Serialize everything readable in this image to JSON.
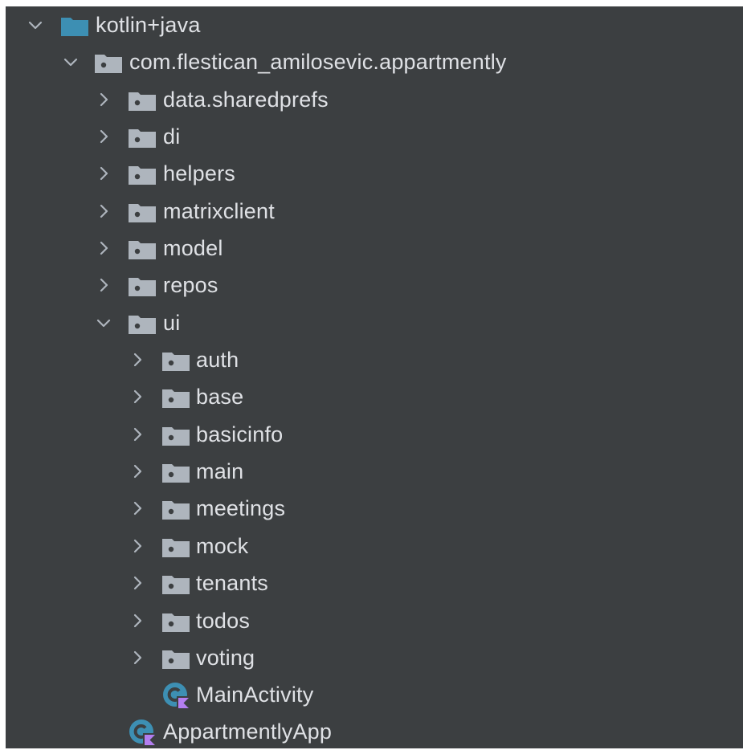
{
  "colors": {
    "background": "#3c3f41",
    "text": "#dfe1e5",
    "source_root_folder": "#3d8fb3",
    "package_folder": "#aeb5bd",
    "chevron": "#aeb5bd",
    "class_icon": "#3d8fb3",
    "kotlin_badge": "#b37ef0"
  },
  "tree": {
    "root": {
      "label": "kotlin+java",
      "expanded": true,
      "icon": "source-root-folder-icon"
    },
    "package": {
      "label": "com.flestican_amilosevic.appartmently",
      "expanded": true,
      "icon": "package-folder-icon"
    },
    "level2": [
      {
        "label": "data.sharedprefs",
        "expanded": false
      },
      {
        "label": "di",
        "expanded": false
      },
      {
        "label": "helpers",
        "expanded": false
      },
      {
        "label": "matrixclient",
        "expanded": false
      },
      {
        "label": "model",
        "expanded": false
      },
      {
        "label": "repos",
        "expanded": false
      },
      {
        "label": "ui",
        "expanded": true
      }
    ],
    "ui_children": [
      {
        "label": "auth",
        "expanded": false
      },
      {
        "label": "base",
        "expanded": false
      },
      {
        "label": "basicinfo",
        "expanded": false
      },
      {
        "label": "main",
        "expanded": false
      },
      {
        "label": "meetings",
        "expanded": false
      },
      {
        "label": "mock",
        "expanded": false
      },
      {
        "label": "tenants",
        "expanded": false
      },
      {
        "label": "todos",
        "expanded": false
      },
      {
        "label": "voting",
        "expanded": false
      }
    ],
    "ui_files": [
      {
        "label": "MainActivity",
        "icon": "kotlin-class-icon"
      }
    ],
    "package_files": [
      {
        "label": "AppartmentlyApp",
        "icon": "kotlin-class-icon"
      }
    ]
  }
}
